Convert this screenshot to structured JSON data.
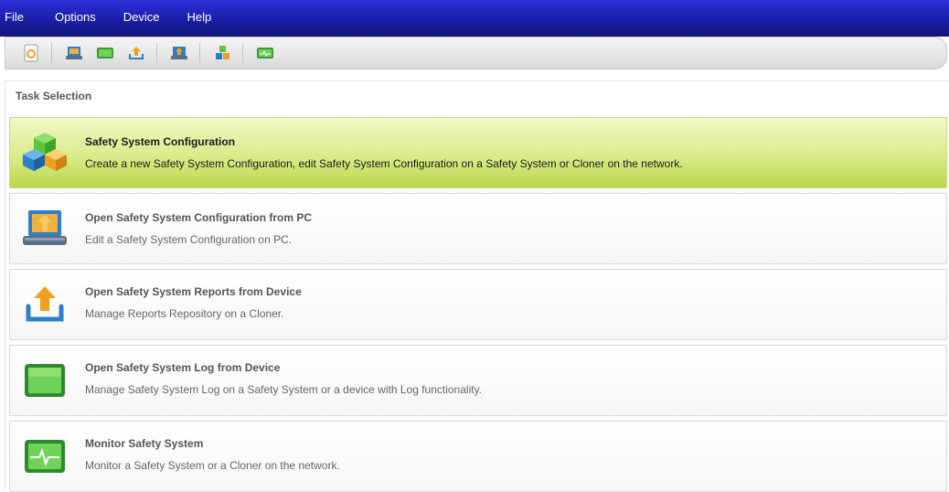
{
  "menubar": {
    "items": [
      "File",
      "Options",
      "Device",
      "Help"
    ]
  },
  "toolbar": {
    "buttons": [
      {
        "icon": "refresh-icon"
      },
      {
        "icon": "laptop-icon"
      },
      {
        "icon": "screen-icon"
      },
      {
        "icon": "upload-icon"
      },
      {
        "icon": "laptop-upload-icon"
      },
      {
        "icon": "cubes-icon"
      },
      {
        "icon": "monitor-icon"
      }
    ]
  },
  "task_selection": {
    "title": "Task Selection",
    "tasks": [
      {
        "title": "Safety System Configuration",
        "description": "Create a new Safety System Configuration, edit Safety System Configuration on a Safety System or Cloner on the network.",
        "icon": "cubes-icon",
        "selected": true
      },
      {
        "title": "Open Safety System Configuration from PC",
        "description": "Edit a Safety System Configuration on PC.",
        "icon": "laptop-icon",
        "selected": false
      },
      {
        "title": "Open Safety System Reports from Device",
        "description": "Manage Reports Repository on a Cloner.",
        "icon": "upload-icon",
        "selected": false
      },
      {
        "title": "Open Safety System Log from Device",
        "description": "Manage Safety System Log on a Safety System or a device with Log functionality.",
        "icon": "screen-icon",
        "selected": false
      },
      {
        "title": "Monitor Safety System",
        "description": "Monitor a Safety System or a Cloner on the network.",
        "icon": "monitor-icon",
        "selected": false
      }
    ]
  },
  "colors": {
    "menubar": "#1a1fa6",
    "selected_task": "#d9ec8a",
    "accent_orange": "#f0a020",
    "accent_blue": "#2d7fc8",
    "accent_green": "#5cc63c"
  }
}
